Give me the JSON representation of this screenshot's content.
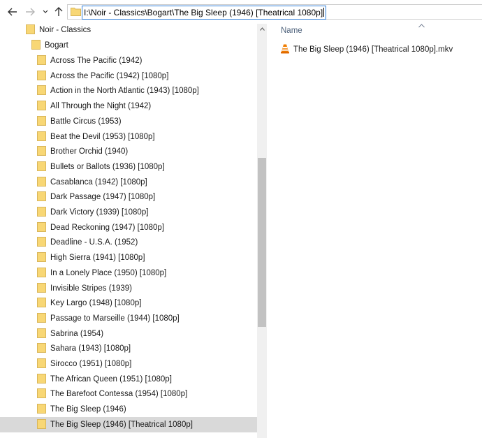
{
  "address_bar": {
    "path": "I:\\Noir - Classics\\Bogart\\The Big Sleep (1946) [Theatrical 1080p]"
  },
  "nav_buttons": {
    "back_icon": "arrow-left-icon",
    "forward_icon": "arrow-right-icon",
    "recent_icon": "chevron-down-icon",
    "up_icon": "arrow-up-icon"
  },
  "tree": {
    "root": "Noir - Classics",
    "parent": "Bogart",
    "items": [
      "Across The Pacific (1942)",
      "Across the Pacific (1942) [1080p]",
      "Action in the North Atlantic (1943) [1080p]",
      "All Through the Night (1942)",
      "Battle Circus (1953)",
      "Beat the Devil (1953) [1080p]",
      "Brother Orchid (1940)",
      "Bullets or Ballots (1936) [1080p]",
      "Casablanca (1942) [1080p]",
      "Dark Passage (1947) [1080p]",
      "Dark Victory (1939) [1080p]",
      "Dead Reckoning (1947) [1080p]",
      "Deadline - U.S.A. (1952)",
      "High Sierra (1941) [1080p]",
      "In a Lonely Place (1950) [1080p]",
      "Invisible Stripes (1939)",
      "Key Largo (1948) [1080p]",
      "Passage to Marseille (1944) [1080p]",
      "Sabrina (1954)",
      "Sahara (1943) [1080p]",
      "Sirocco (1951) [1080p]",
      "The African Queen (1951) [1080p]",
      "The Barefoot Contessa (1954) [1080p]",
      "The Big Sleep (1946)",
      "The Big Sleep (1946) [Theatrical 1080p]"
    ],
    "selected": "The Big Sleep (1946) [Theatrical 1080p]"
  },
  "content": {
    "column_header": "Name",
    "sort": "ascending",
    "files": [
      {
        "name": "The Big Sleep (1946) [Theatrical 1080p].mkv",
        "icon": "vlc-cone-icon"
      }
    ]
  },
  "colors": {
    "folder": "#f8d775",
    "folder_edge": "#d9b65a",
    "selection": "#d9d9d9",
    "address_focus": "#2f7dd8",
    "header_text": "#4c607a",
    "vlc_orange": "#f07d00"
  }
}
